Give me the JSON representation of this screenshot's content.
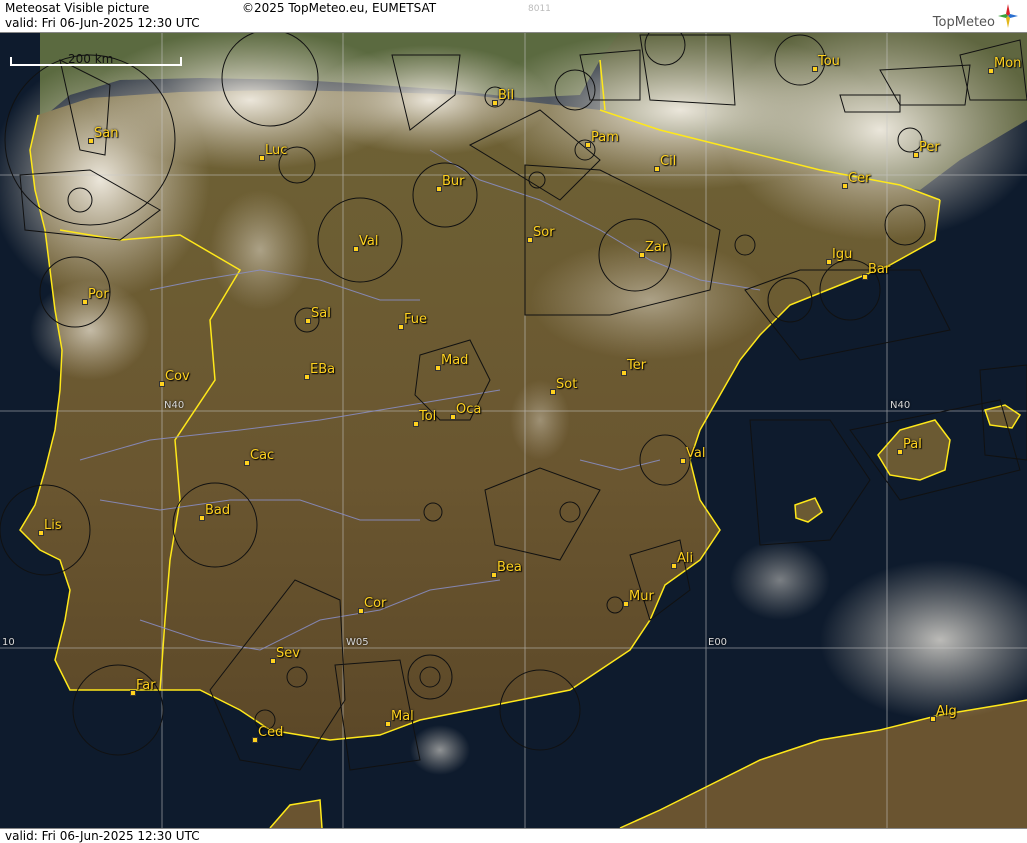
{
  "header": {
    "product": "Meteosat Visible picture",
    "copyright": "©2025 TopMeteo.eu, EUMETSAT",
    "valid": "valid:  Fri  06-Jun-2025  12:30 UTC",
    "code": "8011",
    "logo_text": "TopMeteo"
  },
  "footer": {
    "valid": "valid:  Fri  06-Jun-2025  12:30 UTC"
  },
  "scale": {
    "label": "200 km"
  },
  "grid_labels": {
    "n40_left": "N40",
    "n40_right": "N40",
    "w05": "W05",
    "e00": "E00",
    "w10": "10"
  },
  "cities": [
    {
      "name": "San"
    },
    {
      "name": "Luc"
    },
    {
      "name": "Bil"
    },
    {
      "name": "Pam"
    },
    {
      "name": "Cil"
    },
    {
      "name": "Per"
    },
    {
      "name": "Bur"
    },
    {
      "name": "Cer"
    },
    {
      "name": "Tou"
    },
    {
      "name": "Mon"
    },
    {
      "name": "Val"
    },
    {
      "name": "Sor"
    },
    {
      "name": "Zar"
    },
    {
      "name": "Igu"
    },
    {
      "name": "Bar"
    },
    {
      "name": "Por"
    },
    {
      "name": "Sal"
    },
    {
      "name": "Fue"
    },
    {
      "name": "Mad"
    },
    {
      "name": "Cov"
    },
    {
      "name": "EBa"
    },
    {
      "name": "Ter"
    },
    {
      "name": "Sot"
    },
    {
      "name": "Tol"
    },
    {
      "name": "Oca"
    },
    {
      "name": "Cac"
    },
    {
      "name": "Val"
    },
    {
      "name": "Pal"
    },
    {
      "name": "Bad"
    },
    {
      "name": "Lis"
    },
    {
      "name": "Ali"
    },
    {
      "name": "Bea"
    },
    {
      "name": "Mur"
    },
    {
      "name": "Cor"
    },
    {
      "name": "Sev"
    },
    {
      "name": "Far"
    },
    {
      "name": "Mal"
    },
    {
      "name": "Ced"
    },
    {
      "name": "Alg"
    }
  ],
  "colors": {
    "sea": "#0d1a2b",
    "land": "#6b5a33",
    "border": "#ffe81a",
    "cloud": "#e9e2d4",
    "airspace": "#111111"
  }
}
